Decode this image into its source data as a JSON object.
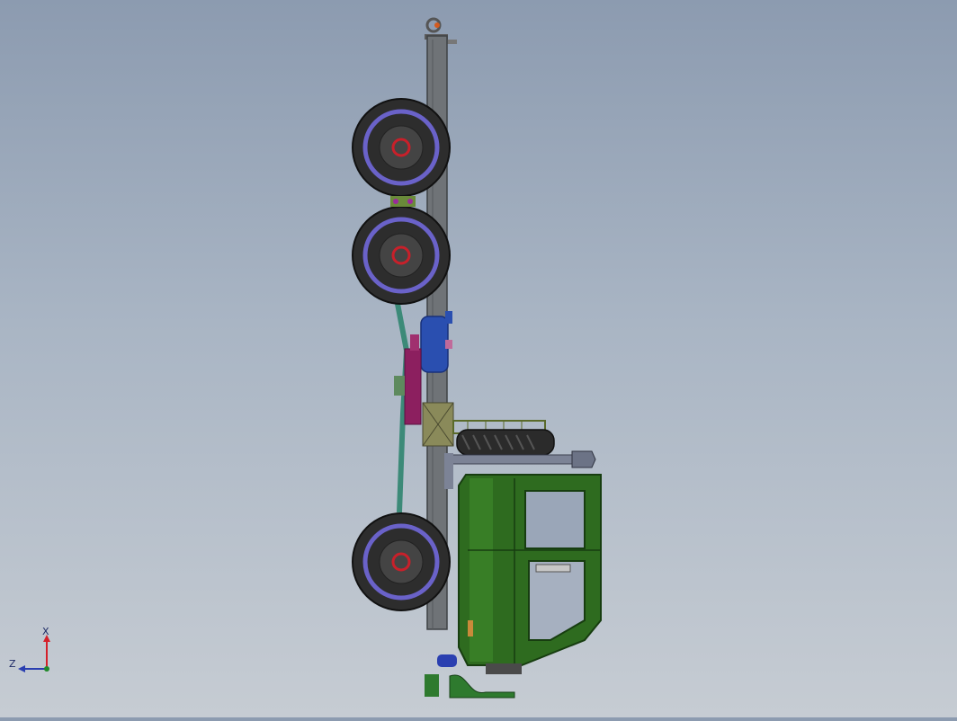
{
  "scene": {
    "subject": "truck-side-view",
    "colors": {
      "cab": "#2e6b1f",
      "cab_light": "#3f8a2b",
      "frame": "#6b6f73",
      "tire": "#2d2d2d",
      "rim_ring": "#6a62c9",
      "hub": "#c8202a",
      "tank": "#2a4fb0",
      "muffler": "#8c1f5f",
      "exhaust_pipe": "#3c8a78"
    }
  },
  "triad": {
    "x_label": "X",
    "z_label": "Z",
    "x_color": "#d4202a",
    "z_color": "#2a3fb0",
    "origin_color": "#1f8a2a"
  }
}
